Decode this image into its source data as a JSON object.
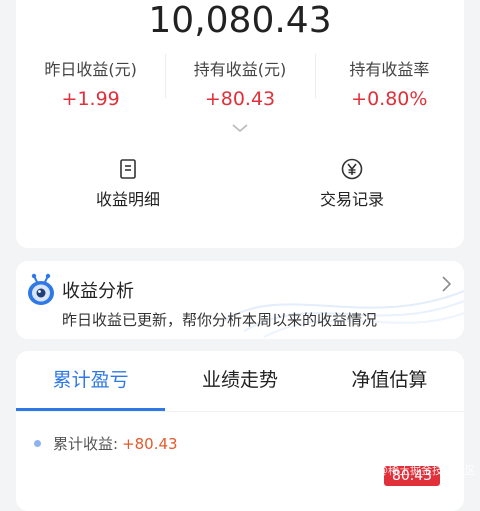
{
  "summary": {
    "total_value": "10,080.43",
    "stats": [
      {
        "label": "昨日收益(元)",
        "value": "+1.99"
      },
      {
        "label": "持有收益(元)",
        "value": "+80.43"
      },
      {
        "label": "持有收益率",
        "value": "+0.80%"
      }
    ],
    "actions": [
      {
        "label": "收益明细",
        "icon": "document-icon"
      },
      {
        "label": "交易记录",
        "icon": "yen-icon"
      }
    ]
  },
  "analysis": {
    "title": "收益分析",
    "description": "昨日收益已更新，帮你分析本周以来的收益情况"
  },
  "performance": {
    "tabs": [
      "累计盈亏",
      "业绩走势",
      "净值估算"
    ],
    "active_tab": 0,
    "legend_label": "累计收益:",
    "legend_value": "+80.43",
    "tag_value": "80.43",
    "watermark": "@稀土掘金技术社区"
  },
  "colors": {
    "accent": "#2f79e6",
    "positive": "#e0313b",
    "legend_value": "#e55a2b"
  }
}
